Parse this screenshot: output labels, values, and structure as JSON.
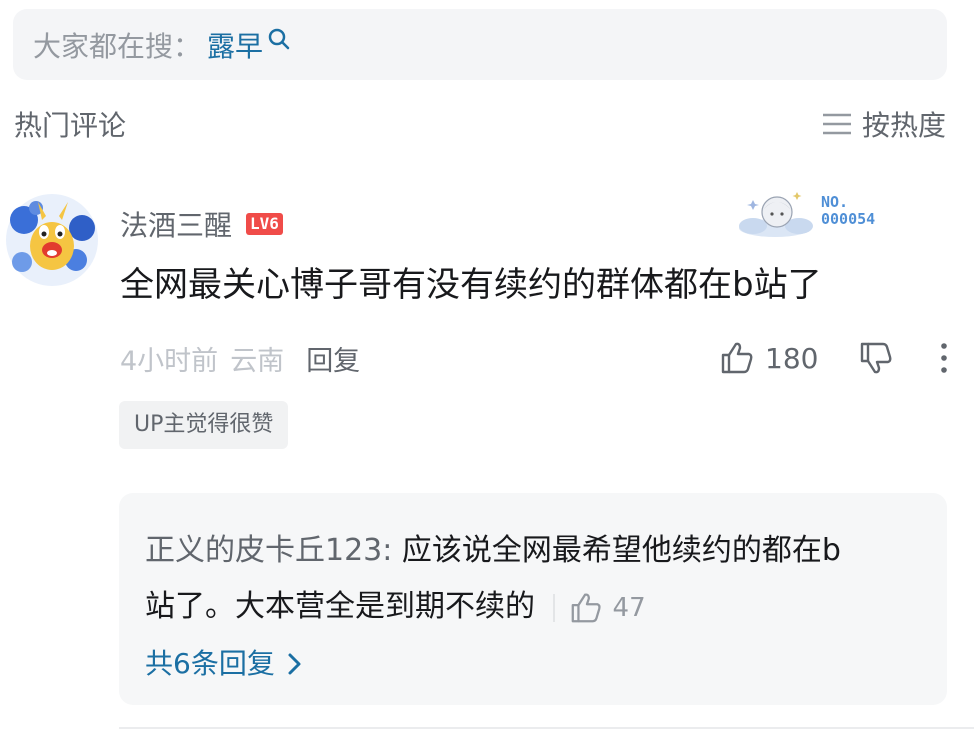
{
  "search": {
    "prefix": "大家都在搜：",
    "keyword": "露早",
    "icon": "search-icon"
  },
  "section": {
    "title": "热门评论",
    "sort_label": "按热度",
    "sort_icon": "sort-lines-icon"
  },
  "comment": {
    "username": "法酒三醒",
    "level": "LV6",
    "fan_badge_number": "NO.\n000054",
    "text": "全网最关心博子哥有没有续约的群体都在b站了",
    "time": "4小时前",
    "location": "云南",
    "reply_label": "回复",
    "like_count": "180",
    "up_tag": "UP主觉得很赞",
    "colors": {
      "level_badge": "#f04c49",
      "link": "#1b6fa3"
    }
  },
  "reply": {
    "user": "正义的皮卡丘123:",
    "text_line1": "应该说全网最希望他续约的都在b",
    "text_line2": "站了。大本营全是到期不续的",
    "like_count": "47",
    "more_replies": "共6条回复"
  }
}
